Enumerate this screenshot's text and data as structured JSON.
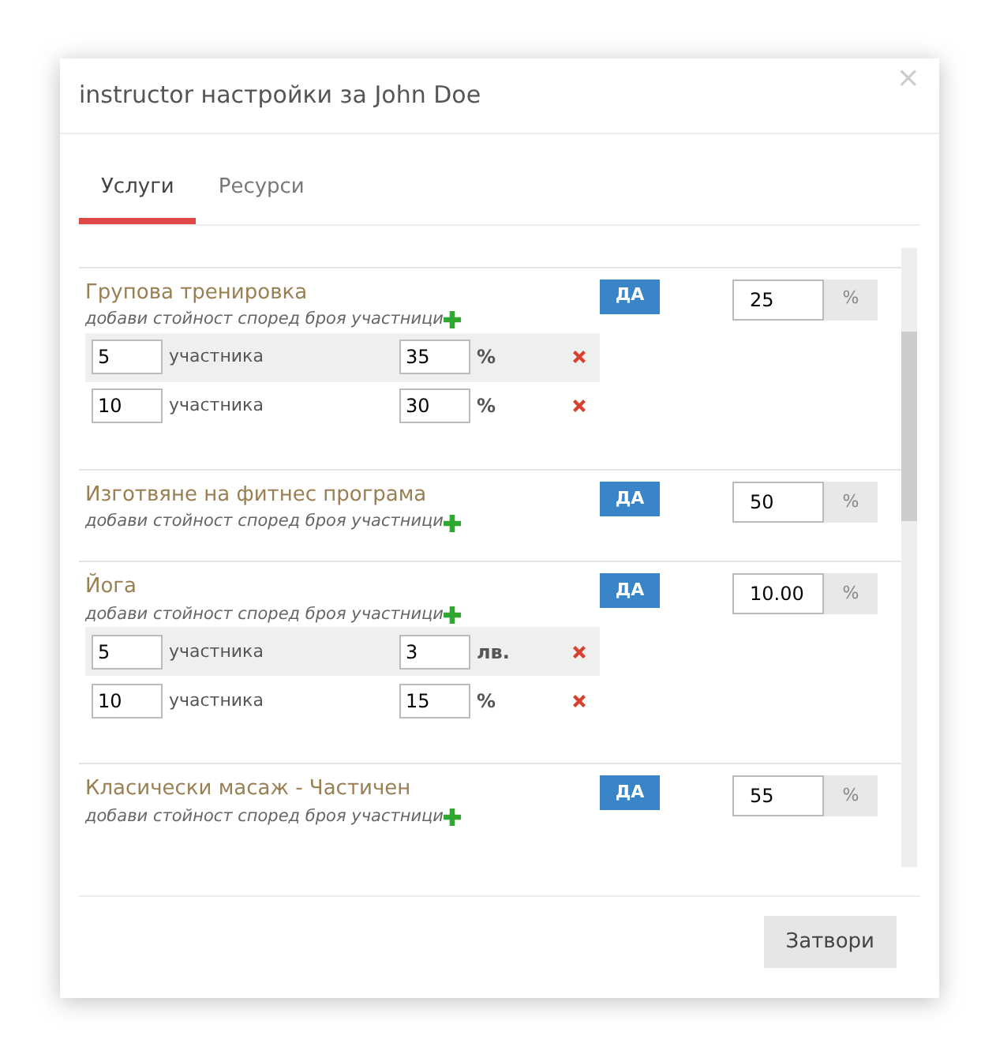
{
  "dialog": {
    "title": "instructor настройки за John Doe",
    "close": "×"
  },
  "tabs": [
    {
      "label": "Услуги",
      "selected": true
    },
    {
      "label": "Ресурси",
      "selected": false
    }
  ],
  "services": [
    {
      "name": "Групова тренировка",
      "add_label": "добави стойност според броя участници",
      "toggle": {
        "label": "ДА",
        "on": true
      },
      "value": "25",
      "unit": "%",
      "tiers": [
        {
          "count": "5",
          "count_label": "участника",
          "value": "35",
          "unit": "%"
        },
        {
          "count": "10",
          "count_label": "участника",
          "value": "30",
          "unit": "%"
        }
      ]
    },
    {
      "name": "Изготвяне на фитнес програма",
      "add_label": "добави стойност според броя участници",
      "toggle": {
        "label": "ДА",
        "on": true
      },
      "value": "50",
      "unit": "%"
    },
    {
      "name": "Йога",
      "add_label": "добави стойност според броя участници",
      "toggle": {
        "label": "ДА",
        "on": true
      },
      "value": "10.00",
      "unit": "%",
      "tiers": [
        {
          "count": "5",
          "count_label": "участника",
          "value": "3",
          "unit": "лв."
        },
        {
          "count": "10",
          "count_label": "участника",
          "value": "15",
          "unit": "%"
        }
      ]
    },
    {
      "name": "Класически масаж - Частичен",
      "add_label": "добави стойност според броя участници",
      "toggle": {
        "label": "ДА",
        "on": true
      },
      "value": "55",
      "unit": "%"
    }
  ],
  "footer": {
    "close_button": "Затвори"
  }
}
